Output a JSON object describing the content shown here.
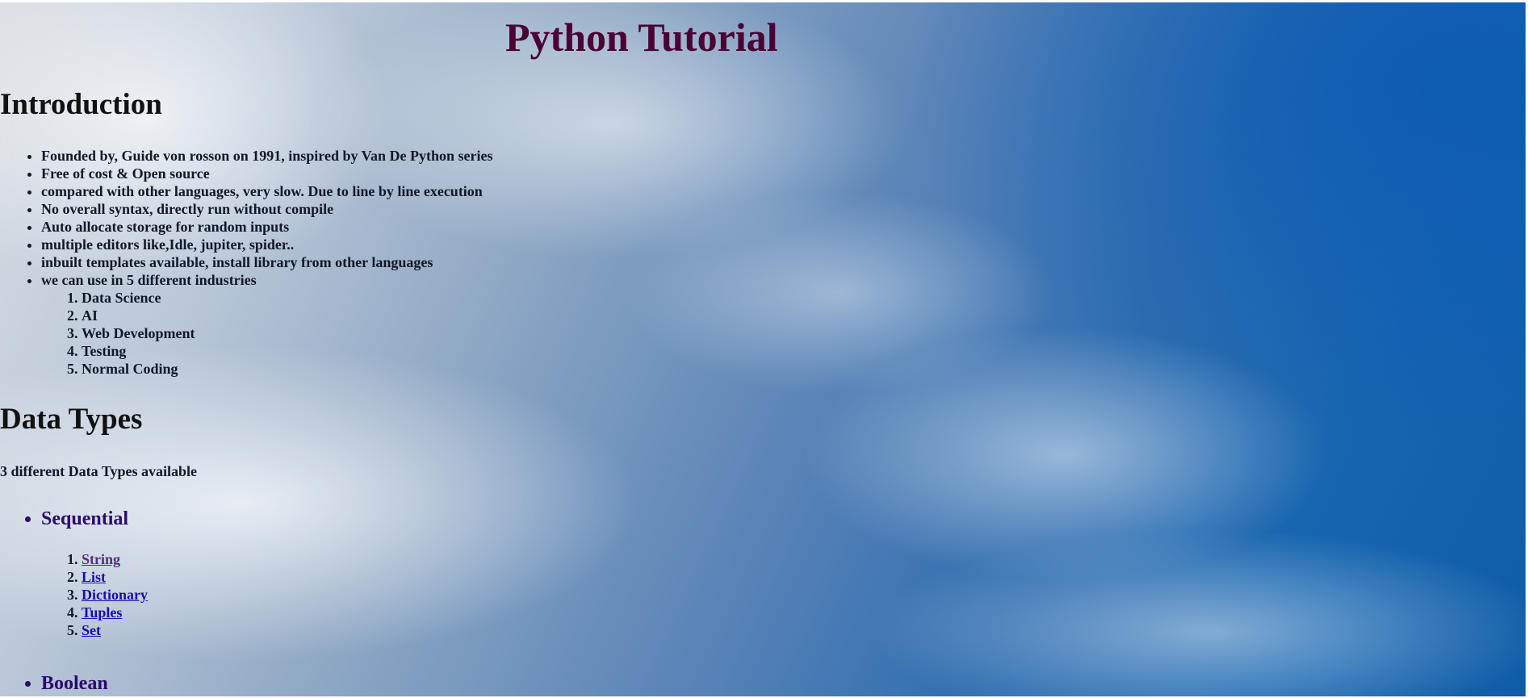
{
  "page": {
    "title": "Python Tutorial"
  },
  "intro": {
    "heading": "Introduction",
    "items": [
      "Founded by, Guide von rosson on 1991, inspired by Van De Python series",
      "Free of cost & Open source",
      "compared with other languages, very slow. Due to line by line execution",
      "No overall syntax, directly run without compile",
      "Auto allocate storage for random inputs",
      "multiple editors like,Idle, jupiter, spider..",
      "inbuilt templates available, install library from other languages",
      "we can use in 5 different industries"
    ],
    "industries": [
      "Data Science",
      "AI",
      "Web Development",
      "Testing",
      "Normal Coding"
    ]
  },
  "data_types": {
    "heading": "Data Types",
    "description": "3 different Data Types available",
    "sequential": {
      "label": "Sequential",
      "links": [
        "String",
        "List",
        "Dictionary",
        "Tuples",
        "Set"
      ]
    },
    "boolean": {
      "label": "Boolean"
    }
  },
  "colors": {
    "title": "#4b0033",
    "type_heading": "#2b0a6e",
    "link": "#1a0dab",
    "visited_link": "#5a2a82"
  }
}
